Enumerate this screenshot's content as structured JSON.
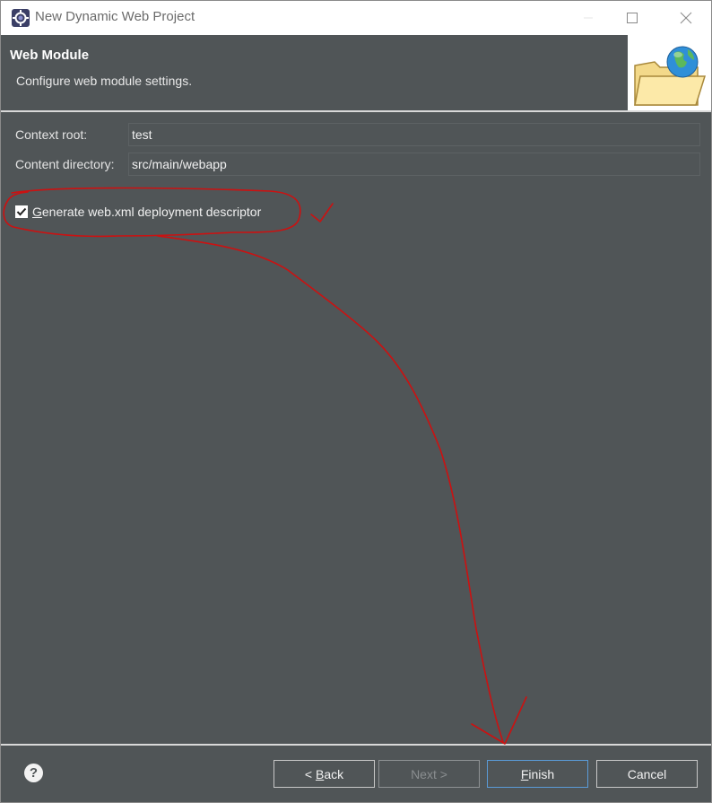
{
  "window": {
    "title": "New Dynamic Web Project",
    "buttons": {
      "minimize": "minimize-icon",
      "maximize": "maximize-icon",
      "close": "close-icon"
    }
  },
  "header": {
    "title": "Web Module",
    "description": "Configure web module settings.",
    "image": "folder-globe-icon"
  },
  "form": {
    "context_root": {
      "label": "Context root:",
      "value": "test"
    },
    "content_directory": {
      "label": "Content directory:",
      "value": "src/main/webapp"
    },
    "generate_descriptor": {
      "mnemonic": "G",
      "label_rest": "enerate web.xml deployment descriptor",
      "checked": true
    }
  },
  "footer": {
    "help": "?",
    "back": {
      "prefix": "< ",
      "mnemonic": "B",
      "rest": "ack"
    },
    "next": {
      "label": "Next >",
      "enabled": false
    },
    "finish": {
      "mnemonic": "F",
      "rest": "inish"
    },
    "cancel": {
      "label": "Cancel"
    }
  },
  "colors": {
    "dialog_bg": "#505557",
    "annotation": "#cc1111",
    "default_button_border": "#5a9bd8"
  }
}
